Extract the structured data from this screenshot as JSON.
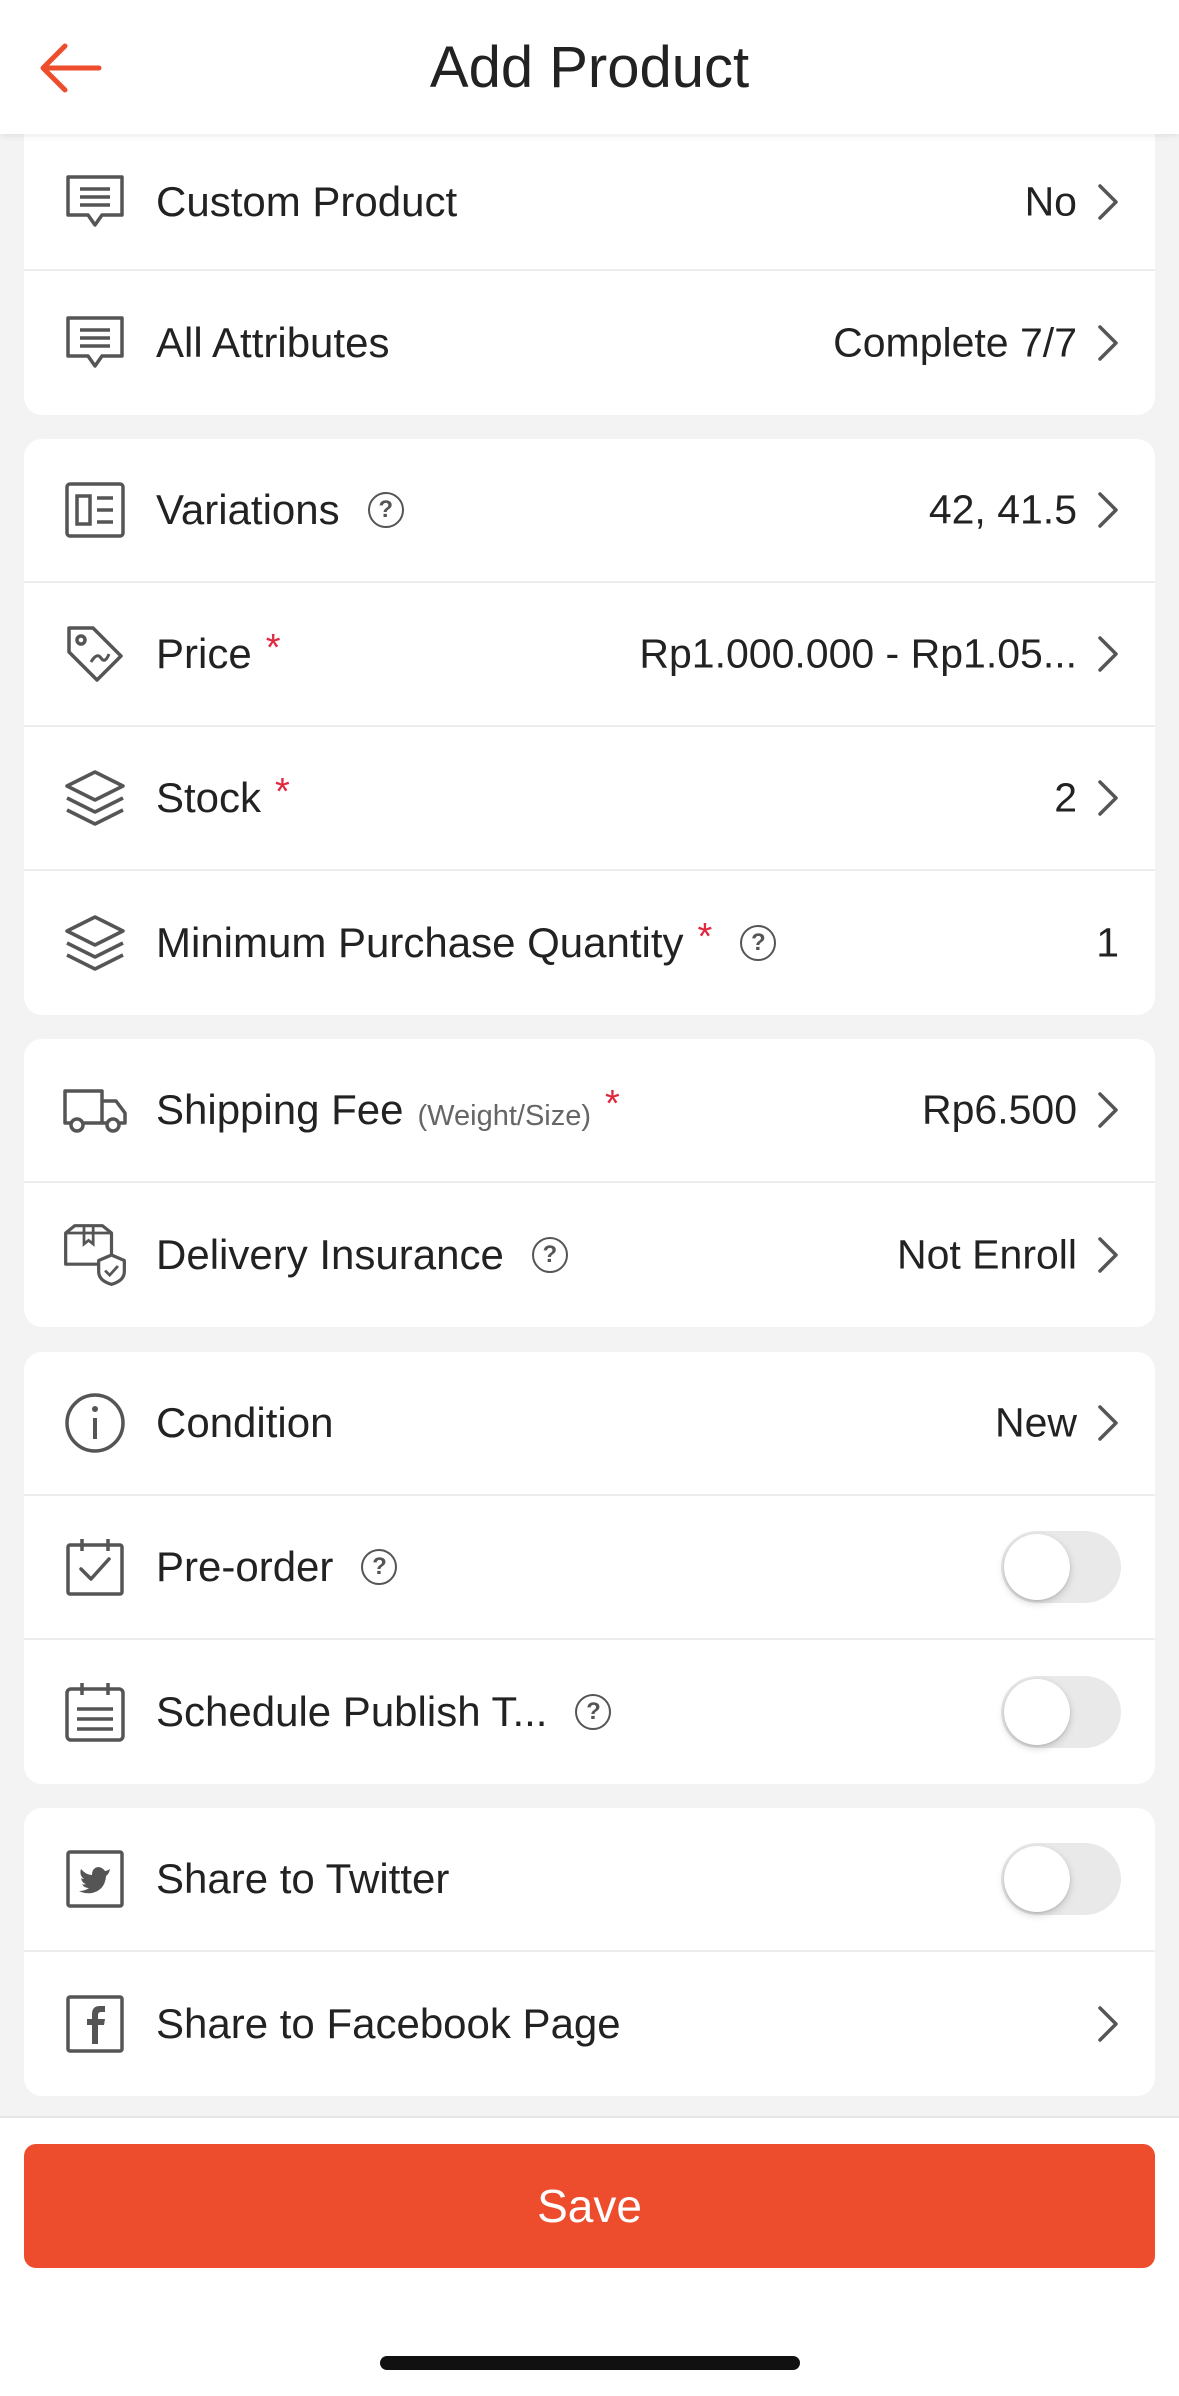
{
  "header": {
    "title": "Add Product"
  },
  "rows": {
    "custom_product": {
      "label": "Custom Product",
      "value": "No"
    },
    "all_attributes": {
      "label": "All Attributes",
      "value": "Complete 7/7"
    },
    "variations": {
      "label": "Variations",
      "value": "42, 41.5"
    },
    "price": {
      "label": "Price",
      "required": "*",
      "value": "Rp1.000.000 - Rp1.05..."
    },
    "stock": {
      "label": "Stock",
      "required": "*",
      "value": "2"
    },
    "min_purchase": {
      "label": "Minimum Purchase Quantity",
      "required": "*",
      "value": "1"
    },
    "shipping_fee": {
      "label": "Shipping Fee",
      "sublabel": "(Weight/Size)",
      "required": "*",
      "value": "Rp6.500"
    },
    "delivery_insurance": {
      "label": "Delivery Insurance",
      "value": "Not Enroll"
    },
    "condition": {
      "label": "Condition",
      "value": "New"
    },
    "pre_order": {
      "label": "Pre-order",
      "enabled": false
    },
    "schedule_publish": {
      "label": "Schedule Publish T...",
      "enabled": false
    },
    "share_twitter": {
      "label": "Share to Twitter",
      "enabled": false
    },
    "share_facebook": {
      "label": "Share to Facebook Page"
    }
  },
  "help_glyph": "?",
  "footer": {
    "save_label": "Save"
  },
  "colors": {
    "accent": "#ee4d2d",
    "required": "#e0283e",
    "icon": "#555555"
  }
}
